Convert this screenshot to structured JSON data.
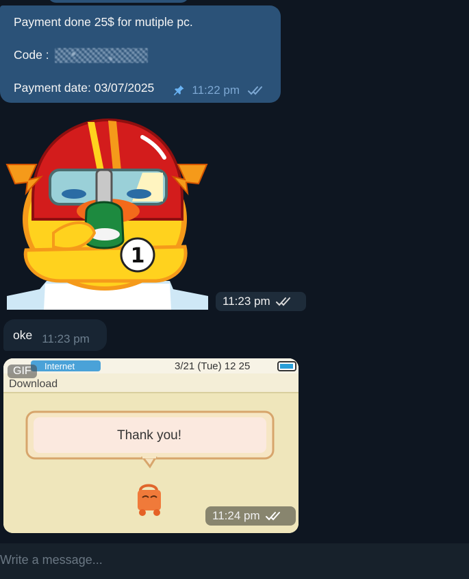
{
  "messages": {
    "payment": {
      "line1": "Payment done 25$ for mutiple pc.",
      "code_label": "Code :",
      "date_line": "Payment date: 03/07/2025",
      "time": "11:22 pm",
      "icons": [
        "pin-icon",
        "double-check-icon"
      ]
    },
    "sticker": {
      "badge_number": "1",
      "time": "11:23 pm"
    },
    "oke": {
      "text": "oke",
      "time": "11:23 pm"
    },
    "gif": {
      "badge": "GIF",
      "status_app": "Internet",
      "status_date": "3/21 (Tue)  12 25",
      "header": "Download",
      "speech": "Thank you!",
      "time": "11:24 pm"
    }
  },
  "composer": {
    "placeholder": "Write a message..."
  },
  "colors": {
    "background": "#0e1621",
    "outgoing_bubble": "#2b5278",
    "incoming_bubble": "#182533",
    "meta_blue": "#7da8d3"
  }
}
